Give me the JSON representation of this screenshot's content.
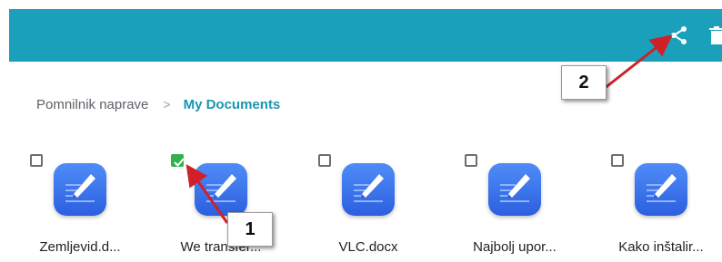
{
  "toolbar": {
    "share_icon": "share-icon",
    "delete_icon": "trash-icon",
    "bar_color": "#1aa0ba"
  },
  "breadcrumb": {
    "root": "Pomnilnik naprave",
    "separator": ">",
    "current": "My Documents"
  },
  "files": [
    {
      "name": "Zemljevid.d...",
      "checked": false,
      "icon": "pen-document-icon"
    },
    {
      "name": "We transfer...",
      "checked": true,
      "icon": "pen-document-icon"
    },
    {
      "name": "VLC.docx",
      "checked": false,
      "icon": "pen-document-icon"
    },
    {
      "name": "Najbolj upor...",
      "checked": false,
      "icon": "pen-document-icon"
    },
    {
      "name": "Kako inštalir...",
      "checked": false,
      "icon": "pen-document-icon"
    }
  ],
  "annotations": {
    "callout_1": "1",
    "callout_2": "2",
    "arrow_color": "#d0202a"
  }
}
